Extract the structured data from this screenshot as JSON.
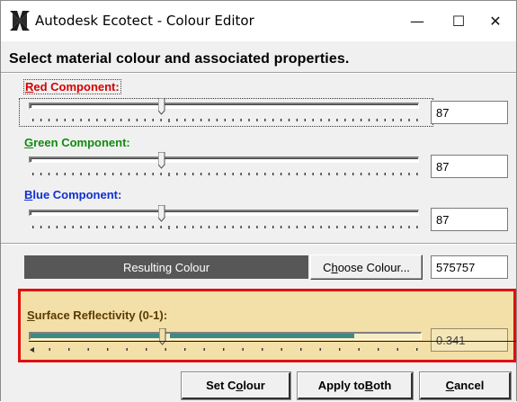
{
  "window": {
    "title": "Autodesk Ecotect - Colour Editor",
    "minimize_glyph": "—",
    "maximize_glyph": "☐",
    "close_glyph": "✕",
    "icon": "ecotect-app-icon"
  },
  "header": "Select material colour and associated properties.",
  "red": {
    "label_prefix": "R",
    "label_rest": "ed Component:",
    "value": "87",
    "slider_level": 87,
    "slider_max": 255,
    "color": "#d40000"
  },
  "green": {
    "label_prefix": "G",
    "label_rest": "reen Component:",
    "value": "87",
    "slider_level": 87,
    "slider_max": 255,
    "color": "#118a11"
  },
  "blue": {
    "label_prefix": "B",
    "label_rest": "lue Component:",
    "value": "87",
    "slider_level": 87,
    "slider_max": 255,
    "color": "#1030d0"
  },
  "result": {
    "label": "Resulting Colour",
    "swatch": "#575757",
    "choose_prefix": "C",
    "choose_u": "h",
    "choose_rest": "oose Colour...",
    "hex_value": "575757"
  },
  "reflectivity": {
    "label_prefix": "S",
    "label_rest": "urface Reflectivity (0-1):",
    "value": "0.341",
    "slider_level": 0.341,
    "panel_color": "#f3dfa8",
    "highlight_color": "#e01010"
  },
  "buttons": {
    "set_pre": "Set C",
    "set_u": "o",
    "set_post": "lour",
    "apply_pre": "Apply to ",
    "apply_u": "B",
    "apply_post": "oth",
    "cancel_u": "C",
    "cancel_post": "ancel"
  }
}
